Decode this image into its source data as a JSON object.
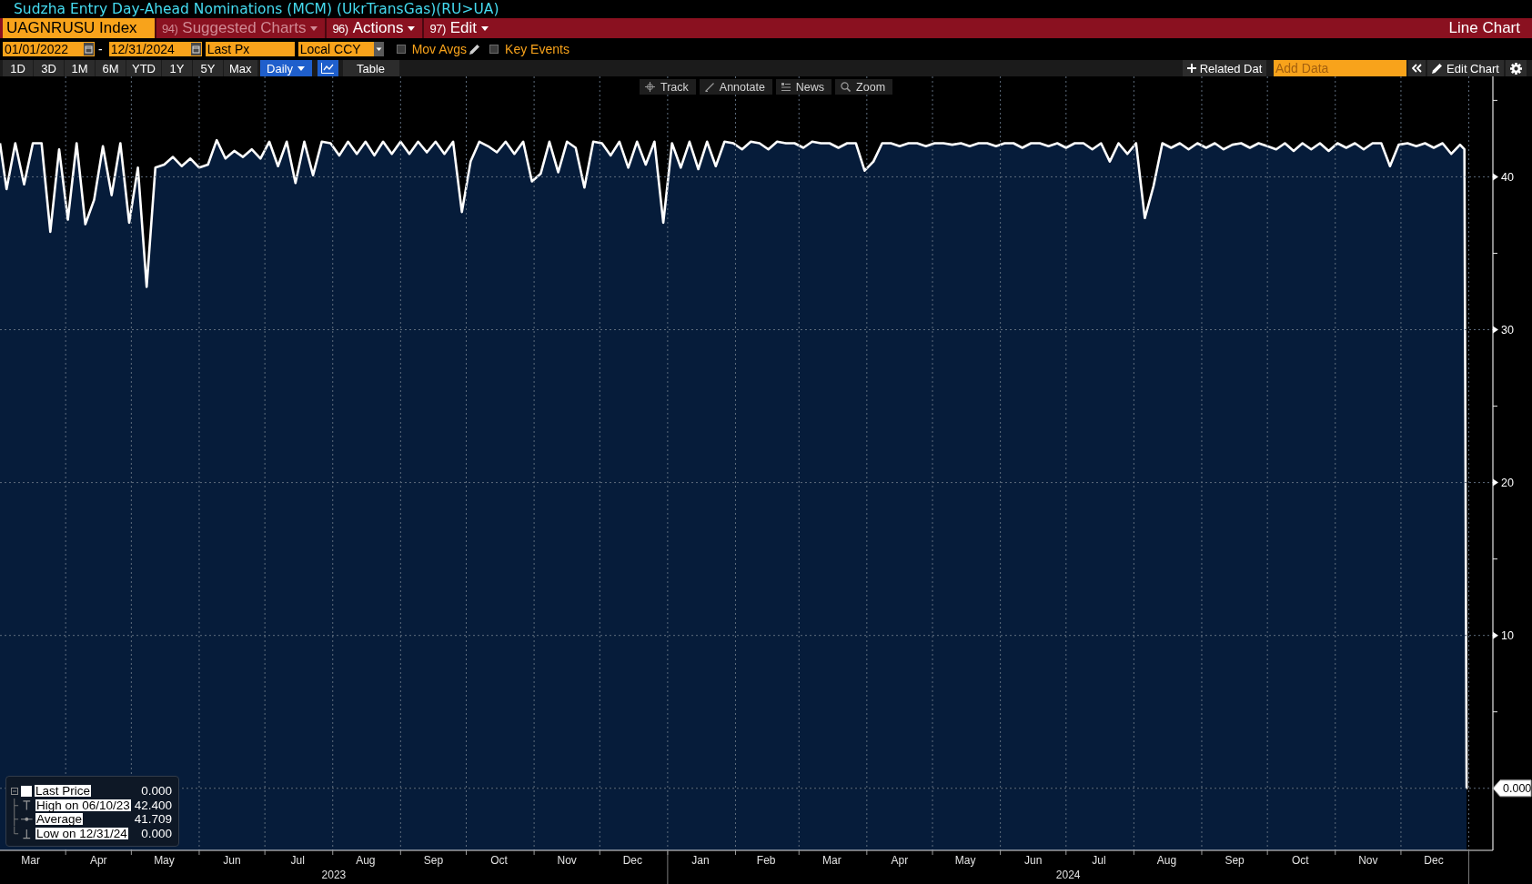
{
  "title": "Sudzha Entry Day-Ahead Nominations (MCM) (UkrTransGas)(RU>UA)",
  "menu_bar": {
    "ticker": "UAGNRUSU Index",
    "buttons": [
      {
        "number": "94)",
        "label": "Suggested Charts",
        "disabled": true
      },
      {
        "number": "96)",
        "label": "Actions",
        "disabled": false
      },
      {
        "number": "97)",
        "label": "Edit",
        "disabled": false
      }
    ],
    "chart_type": "Line Chart"
  },
  "controls": {
    "start_date": "01/01/2022",
    "date_separator": "-",
    "end_date": "12/31/2024",
    "field": "Last Px",
    "currency": "Local CCY",
    "checkboxes": [
      {
        "kind": "editable",
        "label": "Mov Avgs",
        "checked": false
      },
      {
        "kind": "plain",
        "label": "Key Events",
        "checked": false
      }
    ]
  },
  "range_bar": {
    "ranges": [
      {
        "label": "1D",
        "selected": false
      },
      {
        "label": "3D",
        "selected": false
      },
      {
        "label": "1M",
        "selected": false
      },
      {
        "label": "6M",
        "selected": false
      },
      {
        "label": "YTD",
        "selected": false
      },
      {
        "label": "1Y",
        "selected": false
      },
      {
        "label": "5Y",
        "selected": false
      },
      {
        "label": "Max",
        "selected": false
      }
    ],
    "period": "Daily",
    "views": [
      {
        "kind": "chart",
        "selected": true
      },
      {
        "kind": "table",
        "label": "Table",
        "selected": false
      }
    ],
    "related_data": "Related Dat",
    "add_data": {
      "placeholder": "Add Data"
    },
    "edit_chart": "Edit Chart"
  },
  "chart": {
    "tools": [
      {
        "kind": "track",
        "label": "Track"
      },
      {
        "kind": "annotate",
        "label": "Annotate"
      },
      {
        "kind": "news",
        "label": "News"
      },
      {
        "kind": "zoom",
        "label": "Zoom"
      }
    ],
    "chart_data": {
      "type": "area",
      "x": [
        "2023-03-02",
        "2023-03-05",
        "2023-03-09",
        "2023-03-13",
        "2023-03-17",
        "2023-03-21",
        "2023-03-25",
        "2023-03-29",
        "2023-04-02",
        "2023-04-06",
        "2023-04-10",
        "2023-04-14",
        "2023-04-18",
        "2023-04-22",
        "2023-04-26",
        "2023-04-30",
        "2023-05-04",
        "2023-05-08",
        "2023-05-12",
        "2023-05-16",
        "2023-05-20",
        "2023-05-24",
        "2023-05-28",
        "2023-06-01",
        "2023-06-05",
        "2023-06-09",
        "2023-06-13",
        "2023-06-17",
        "2023-06-21",
        "2023-06-25",
        "2023-06-29",
        "2023-07-03",
        "2023-07-07",
        "2023-07-11",
        "2023-07-15",
        "2023-07-19",
        "2023-07-23",
        "2023-07-27",
        "2023-07-31",
        "2023-08-04",
        "2023-08-08",
        "2023-08-12",
        "2023-08-16",
        "2023-08-20",
        "2023-08-24",
        "2023-08-28",
        "2023-09-01",
        "2023-09-05",
        "2023-09-09",
        "2023-09-13",
        "2023-09-17",
        "2023-09-21",
        "2023-09-25",
        "2023-09-29",
        "2023-10-03",
        "2023-10-07",
        "2023-10-11",
        "2023-10-15",
        "2023-10-19",
        "2023-10-23",
        "2023-10-27",
        "2023-10-31",
        "2023-11-04",
        "2023-11-08",
        "2023-11-12",
        "2023-11-16",
        "2023-11-20",
        "2023-11-24",
        "2023-11-28",
        "2023-12-02",
        "2023-12-06",
        "2023-12-10",
        "2023-12-14",
        "2023-12-18",
        "2023-12-22",
        "2023-12-26",
        "2023-12-30",
        "2024-01-03",
        "2024-01-07",
        "2024-01-11",
        "2024-01-15",
        "2024-01-19",
        "2024-01-23",
        "2024-01-27",
        "2024-01-31",
        "2024-02-04",
        "2024-02-08",
        "2024-02-12",
        "2024-02-16",
        "2024-02-20",
        "2024-02-24",
        "2024-02-28",
        "2024-03-03",
        "2024-03-07",
        "2024-03-11",
        "2024-03-15",
        "2024-03-19",
        "2024-03-23",
        "2024-03-27",
        "2024-03-31",
        "2024-04-04",
        "2024-04-08",
        "2024-04-12",
        "2024-04-16",
        "2024-04-20",
        "2024-04-24",
        "2024-04-28",
        "2024-05-02",
        "2024-05-06",
        "2024-05-10",
        "2024-05-14",
        "2024-05-18",
        "2024-05-22",
        "2024-05-26",
        "2024-05-30",
        "2024-06-03",
        "2024-06-07",
        "2024-06-11",
        "2024-06-15",
        "2024-06-19",
        "2024-06-23",
        "2024-06-27",
        "2024-07-01",
        "2024-07-05",
        "2024-07-09",
        "2024-07-13",
        "2024-07-17",
        "2024-07-21",
        "2024-07-25",
        "2024-07-29",
        "2024-08-02",
        "2024-08-06",
        "2024-08-10",
        "2024-08-14",
        "2024-08-18",
        "2024-08-22",
        "2024-08-26",
        "2024-08-30",
        "2024-09-03",
        "2024-09-07",
        "2024-09-11",
        "2024-09-15",
        "2024-09-19",
        "2024-09-23",
        "2024-09-27",
        "2024-10-01",
        "2024-10-05",
        "2024-10-09",
        "2024-10-13",
        "2024-10-17",
        "2024-10-21",
        "2024-10-25",
        "2024-10-29",
        "2024-11-02",
        "2024-11-06",
        "2024-11-10",
        "2024-11-14",
        "2024-11-18",
        "2024-11-22",
        "2024-11-26",
        "2024-11-30",
        "2024-12-04",
        "2024-12-08",
        "2024-12-12",
        "2024-12-16",
        "2024-12-20",
        "2024-12-24",
        "2024-12-28",
        "2024-12-30",
        "2024-12-31"
      ],
      "series": [
        {
          "name": "Last Price",
          "color": "#ffffff",
          "values": [
            42.2,
            39.2,
            42.2,
            39.5,
            42.2,
            42.2,
            36.4,
            41.8,
            37.2,
            42.2,
            36.9,
            38.5,
            42.0,
            38.8,
            42.2,
            37.0,
            40.6,
            32.8,
            40.6,
            40.8,
            41.3,
            40.7,
            41.2,
            40.6,
            40.8,
            42.4,
            41.2,
            41.7,
            41.3,
            41.8,
            41.2,
            42.3,
            40.7,
            42.3,
            39.6,
            42.3,
            40.1,
            42.3,
            42.2,
            41.4,
            42.3,
            41.5,
            42.3,
            41.4,
            42.3,
            41.5,
            42.3,
            41.5,
            42.3,
            41.6,
            42.3,
            41.5,
            42.3,
            37.7,
            41.0,
            42.3,
            42.0,
            41.6,
            42.3,
            41.5,
            42.3,
            39.7,
            40.2,
            42.3,
            40.3,
            42.3,
            41.9,
            39.3,
            42.3,
            42.2,
            41.4,
            42.3,
            40.6,
            42.3,
            40.8,
            42.3,
            37.0,
            42.2,
            40.6,
            42.3,
            40.5,
            42.3,
            40.7,
            42.3,
            42.2,
            41.8,
            42.3,
            42.2,
            41.8,
            42.3,
            42.2,
            42.2,
            41.9,
            42.3,
            42.2,
            42.2,
            41.9,
            42.2,
            42.2,
            40.4,
            41.0,
            42.2,
            42.2,
            42.0,
            42.2,
            42.2,
            42.0,
            42.2,
            42.2,
            42.1,
            42.2,
            42.0,
            42.2,
            42.2,
            42.0,
            42.2,
            42.2,
            41.9,
            42.2,
            42.2,
            42.0,
            42.2,
            41.9,
            42.2,
            42.2,
            41.8,
            42.2,
            41.0,
            42.2,
            41.5,
            42.2,
            37.3,
            39.4,
            42.2,
            41.9,
            42.2,
            41.8,
            42.2,
            41.9,
            42.2,
            41.8,
            42.1,
            42.2,
            41.9,
            42.2,
            42.0,
            41.8,
            42.2,
            41.7,
            42.2,
            41.8,
            42.2,
            41.7,
            42.2,
            41.9,
            42.2,
            41.8,
            42.2,
            42.2,
            40.7,
            42.1,
            42.2,
            42.0,
            42.2,
            41.9,
            42.2,
            41.5,
            42.1,
            41.8,
            0
          ]
        }
      ],
      "xlim": [
        "2023-03-02",
        "2025-01-12"
      ],
      "ylim": [
        -4.06,
        46.57
      ],
      "xticks": [
        {
          "value": "2023-03-16",
          "label": "Mar"
        },
        {
          "value": "2023-04-16",
          "label": "Apr"
        },
        {
          "value": "2023-05-16",
          "label": "May"
        },
        {
          "value": "2023-06-16",
          "label": "Jun"
        },
        {
          "value": "2023-07-16",
          "label": "Jul"
        },
        {
          "value": "2023-08-16",
          "label": "Aug"
        },
        {
          "value": "2023-09-16",
          "label": "Sep"
        },
        {
          "value": "2023-10-16",
          "label": "Oct"
        },
        {
          "value": "2023-11-16",
          "label": "Nov"
        },
        {
          "value": "2023-12-16",
          "label": "Dec"
        },
        {
          "value": "2024-01-16",
          "label": "Jan"
        },
        {
          "value": "2024-02-15",
          "label": "Feb"
        },
        {
          "value": "2024-03-16",
          "label": "Mar"
        },
        {
          "value": "2024-04-16",
          "label": "Apr"
        },
        {
          "value": "2024-05-16",
          "label": "May"
        },
        {
          "value": "2024-06-16",
          "label": "Jun"
        },
        {
          "value": "2024-07-16",
          "label": "Jul"
        },
        {
          "value": "2024-08-16",
          "label": "Aug"
        },
        {
          "value": "2024-09-16",
          "label": "Sep"
        },
        {
          "value": "2024-10-16",
          "label": "Oct"
        },
        {
          "value": "2024-11-16",
          "label": "Nov"
        },
        {
          "value": "2024-12-16",
          "label": "Dec"
        }
      ],
      "yticks": [
        10,
        20,
        30,
        40
      ],
      "grid": true
    },
    "year_labels": [
      "2023",
      "2024"
    ],
    "last_price_tag": "0.000",
    "legend": {
      "rows": [
        {
          "kind": "series",
          "value": "0.000"
        },
        {
          "kind": "high",
          "label": "High on 06/10/23",
          "value": "42.400"
        },
        {
          "kind": "average",
          "label": "Average",
          "value": "41.709"
        },
        {
          "kind": "low",
          "label": "Low on 12/31/24",
          "value": "0.000"
        }
      ]
    }
  }
}
